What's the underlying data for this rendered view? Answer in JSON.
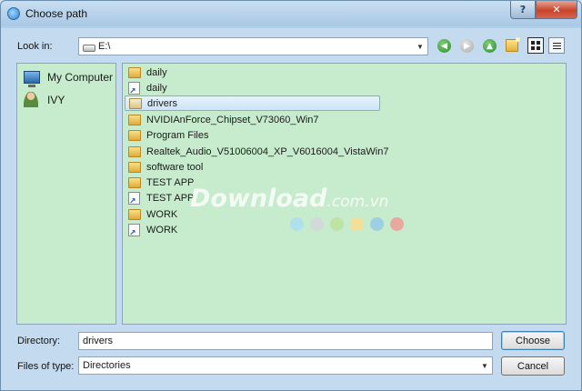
{
  "window": {
    "title": "Choose path"
  },
  "title_buttons": {
    "help": "?",
    "close": "✕"
  },
  "toolbar": {
    "look_in_label": "Look in:",
    "look_in_value": "E:\\",
    "icons": [
      "back-icon",
      "forward-icon",
      "up-icon",
      "new-folder-icon",
      "list-view-icon",
      "detail-view-icon"
    ]
  },
  "places": [
    {
      "label": "My Computer",
      "icon": "computer-icon"
    },
    {
      "label": "IVY",
      "icon": "user-icon"
    }
  ],
  "files": [
    {
      "name": "daily",
      "type": "folder"
    },
    {
      "name": "daily",
      "type": "shortcut"
    },
    {
      "name": "drivers",
      "type": "folder-open",
      "selected": true
    },
    {
      "name": "NVIDIAnForce_Chipset_V73060_Win7",
      "type": "folder"
    },
    {
      "name": "Program Files",
      "type": "folder"
    },
    {
      "name": "Realtek_Audio_V51006004_XP_V6016004_VistaWin7",
      "type": "folder"
    },
    {
      "name": "software tool",
      "type": "folder"
    },
    {
      "name": "TEST APP",
      "type": "folder"
    },
    {
      "name": "TEST APP",
      "type": "shortcut"
    },
    {
      "name": "WORK",
      "type": "folder"
    },
    {
      "name": "WORK",
      "type": "shortcut"
    }
  ],
  "watermark": {
    "brand": "Download",
    "suffix": ".com.vn"
  },
  "watermark_dot_colors": [
    "#aee0ee",
    "#d3d8d8",
    "#bfe3a5",
    "#f1df9a",
    "#9fcfe2",
    "#e8a89d"
  ],
  "directory": {
    "label": "Directory:",
    "value": "drivers"
  },
  "file_type": {
    "label": "Files of type:",
    "value": "Directories"
  },
  "buttons": {
    "choose": "Choose",
    "cancel": "Cancel"
  }
}
